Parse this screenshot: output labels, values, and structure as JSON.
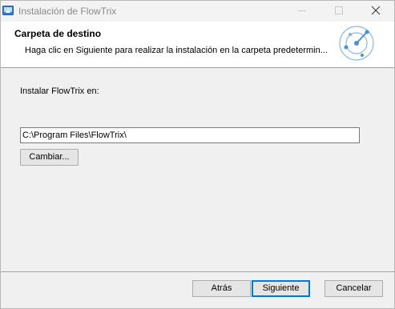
{
  "window": {
    "title": "Instalación de FlowTrix",
    "icon": "installer-app-icon"
  },
  "banner": {
    "title": "Carpeta de destino",
    "description": "Haga clic en Siguiente para realizar la instalación en la carpeta predetermin...",
    "logo": "flowtrix-logo-icon"
  },
  "body": {
    "install_label": "Instalar FlowTrix en:",
    "path_value": "C:\\Program Files\\FlowTrix\\",
    "change_label": "Cambiar..."
  },
  "footer": {
    "back_label": "Atrás",
    "next_label": "Siguiente",
    "cancel_label": "Cancelar"
  },
  "colors": {
    "accent": "#0078d7",
    "logo": "#4a90d9"
  }
}
